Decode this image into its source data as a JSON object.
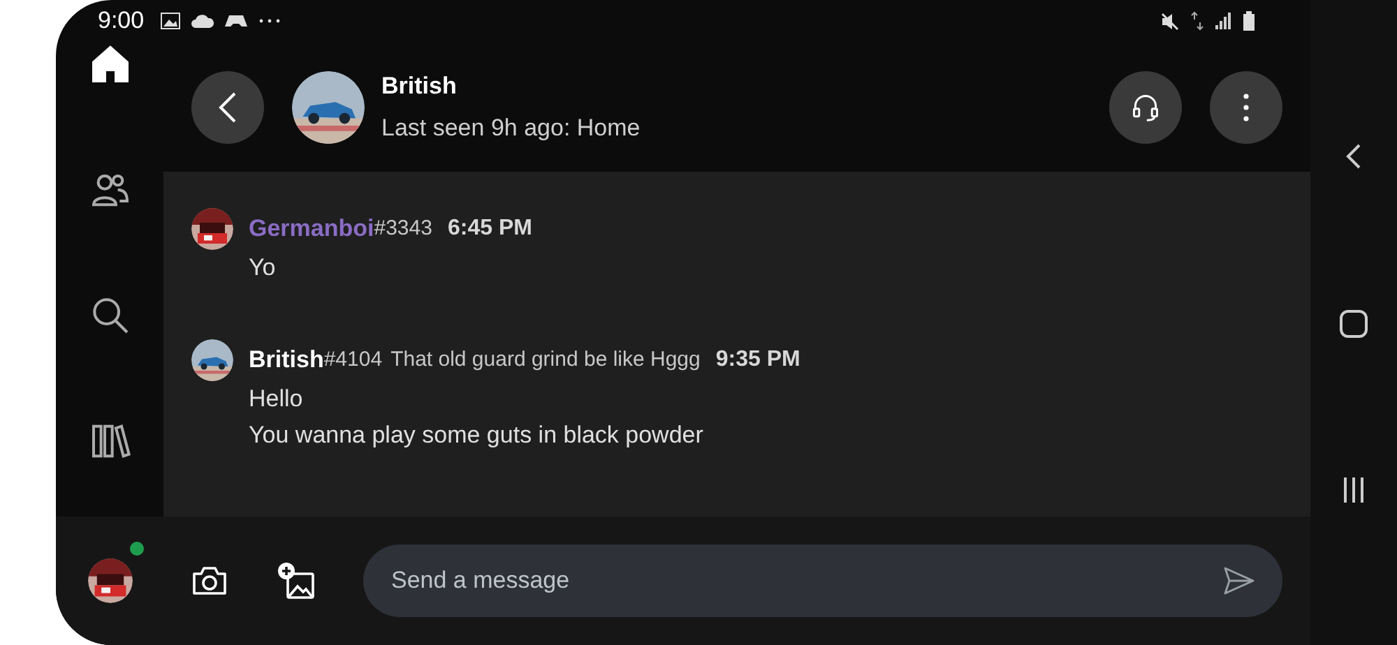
{
  "status_bar": {
    "time": "9:00"
  },
  "sidebar": {
    "items": [
      {
        "kind": "home",
        "selected": true
      },
      {
        "kind": "friends",
        "selected": false
      },
      {
        "kind": "search",
        "selected": false
      },
      {
        "kind": "library",
        "selected": false
      }
    ],
    "profile": {
      "online": true
    }
  },
  "header": {
    "name": "British",
    "subtitle": "Last seen 9h ago: Home"
  },
  "messages": [
    {
      "author": "Germanboi",
      "color": "#8a6cc4",
      "tag": "#3343",
      "time": "6:45 PM",
      "lines": [
        "Yo"
      ]
    },
    {
      "author": "British",
      "color": "#ffffff",
      "tag": "#4104",
      "status": "That old guard grind be like Hggg",
      "time": "9:35 PM",
      "lines": [
        "Hello",
        "You wanna play some guts in black powder"
      ]
    }
  ],
  "composer": {
    "placeholder": "Send a message"
  }
}
